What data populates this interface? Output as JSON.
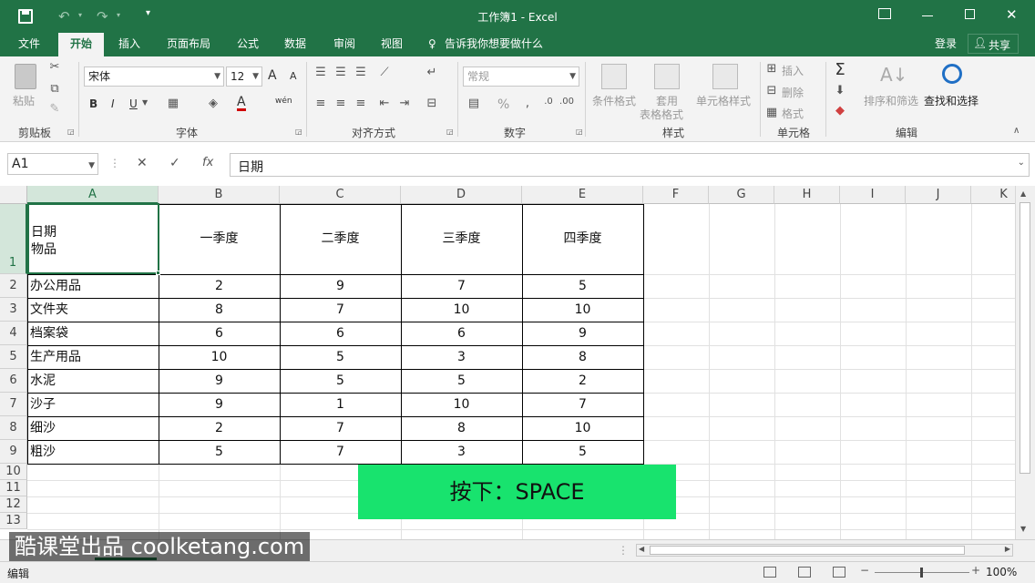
{
  "window": {
    "title": "工作簿1 - Excel",
    "minimize_icon": "minimize-icon",
    "maximize_icon": "maximize-icon",
    "close_icon": "close-icon"
  },
  "quick_access": {
    "save_icon": "save-icon",
    "undo_icon": "undo-icon",
    "redo_icon": "redo-icon",
    "customize_icon": "customize-icon"
  },
  "tabs": [
    {
      "label": "文件"
    },
    {
      "label": "开始"
    },
    {
      "label": "插入"
    },
    {
      "label": "页面布局"
    },
    {
      "label": "公式"
    },
    {
      "label": "数据"
    },
    {
      "label": "审阅"
    },
    {
      "label": "视图"
    }
  ],
  "tell_me": "告诉我你想要做什么",
  "signin": "登录",
  "share": "共享",
  "ribbon": {
    "clipboard": {
      "paste": "粘贴",
      "label": "剪贴板"
    },
    "font": {
      "name": "宋体",
      "size": "12",
      "bold": "B",
      "italic": "I",
      "underline": "U",
      "grow": "A",
      "shrink": "A",
      "color": "A",
      "phonetic": "wén",
      "label": "字体"
    },
    "alignment": {
      "label": "对齐方式"
    },
    "number": {
      "format": "常规",
      "percent": "%",
      "label": "数字"
    },
    "styles": {
      "conditional": "条件格式",
      "table1": "套用",
      "table2": "表格格式",
      "cellstyles": "单元格样式",
      "label": "样式"
    },
    "cells": {
      "insert": "插入",
      "delete": "删除",
      "format": "格式",
      "label": "单元格"
    },
    "editing": {
      "sort": "排序和筛选",
      "find": "查找和选择",
      "label": "编辑"
    }
  },
  "formula_bar": {
    "name_box": "A1",
    "cancel": "✕",
    "enter": "✓",
    "fx": "fx",
    "content": "日期"
  },
  "columns": [
    "A",
    "B",
    "C",
    "D",
    "E",
    "F",
    "G",
    "H",
    "I",
    "J",
    "K"
  ],
  "rows": [
    "1",
    "2",
    "3",
    "4",
    "5",
    "6",
    "7",
    "8",
    "9",
    "10",
    "11",
    "12",
    "13"
  ],
  "table": {
    "header": {
      "a1_line1": "日期",
      "a1_line2": "物品",
      "b": "一季度",
      "c": "二季度",
      "d": "三季度",
      "e": "四季度"
    },
    "body": [
      {
        "item": "办公用品",
        "q1": "2",
        "q2": "9",
        "q3": "7",
        "q4": "5"
      },
      {
        "item": "文件夹",
        "q1": "8",
        "q2": "7",
        "q3": "10",
        "q4": "10"
      },
      {
        "item": "档案袋",
        "q1": "6",
        "q2": "6",
        "q3": "6",
        "q4": "9"
      },
      {
        "item": "生产用品",
        "q1": "10",
        "q2": "5",
        "q3": "3",
        "q4": "8"
      },
      {
        "item": "水泥",
        "q1": "9",
        "q2": "5",
        "q3": "5",
        "q4": "2"
      },
      {
        "item": "沙子",
        "q1": "9",
        "q2": "1",
        "q3": "10",
        "q4": "7"
      },
      {
        "item": "细沙",
        "q1": "2",
        "q2": "7",
        "q3": "8",
        "q4": "10"
      },
      {
        "item": "粗沙",
        "q1": "5",
        "q2": "7",
        "q3": "3",
        "q4": "5"
      }
    ]
  },
  "overlay": "按下：SPACE",
  "watermark": "酷课堂出品 coolketang.com",
  "status": {
    "mode": "编辑",
    "zoom": "100%"
  },
  "colors": {
    "accent": "#217346",
    "overlay": "#18e36e"
  }
}
